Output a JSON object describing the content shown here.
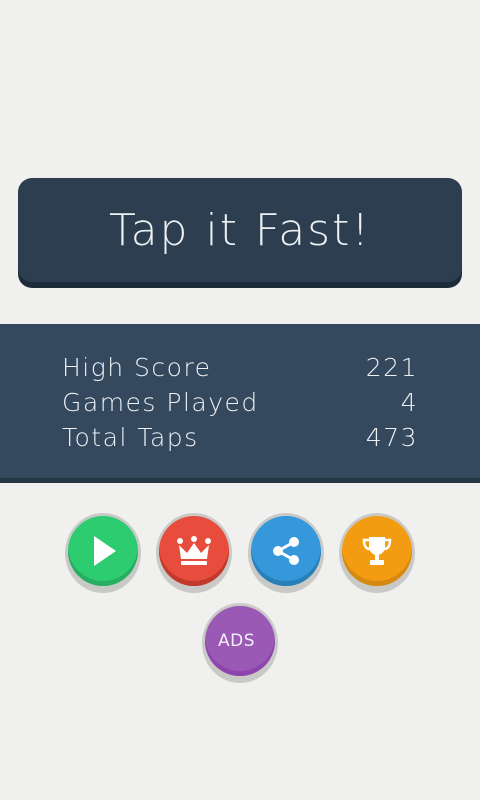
{
  "title": "Tap it Fast!",
  "stats": [
    {
      "label": "High Score",
      "value": "221"
    },
    {
      "label": "Games Played",
      "value": "4"
    },
    {
      "label": "Total Taps",
      "value": "473"
    }
  ],
  "buttons": {
    "play": {
      "icon": "play-icon",
      "color": "#2ecc71",
      "shadow": "#27ae60"
    },
    "leaderboard": {
      "icon": "crown-icon",
      "color": "#e74c3c",
      "shadow": "#c0392b"
    },
    "share": {
      "icon": "share-icon",
      "color": "#3498db",
      "shadow": "#2980b9"
    },
    "achievements": {
      "icon": "trophy-icon",
      "color": "#f39c12",
      "shadow": "#d68910"
    },
    "remove_ads": {
      "label": "ADS",
      "icon": "no-ads-icon",
      "color": "#9b59b6",
      "shadow": "#8e44ad",
      "slash_color": "#c0392b"
    }
  },
  "colors": {
    "background": "#f0f0ef",
    "title_banner": "#2d3e50",
    "stats_panel": "#34495e",
    "text": "#eef1f4"
  }
}
